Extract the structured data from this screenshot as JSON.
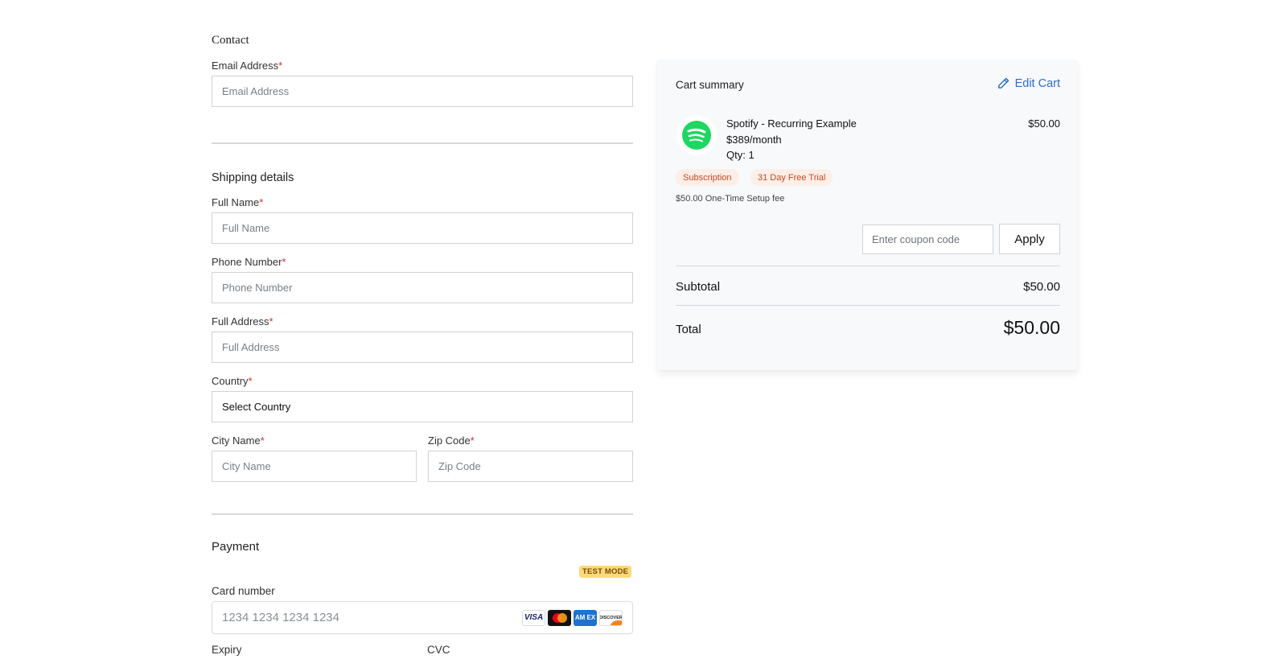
{
  "contact": {
    "title": "Contact",
    "email_label": "Email Address",
    "email_placeholder": "Email Address"
  },
  "shipping": {
    "title": "Shipping details",
    "full_name_label": "Full Name",
    "full_name_placeholder": "Full Name",
    "phone_label": "Phone Number",
    "phone_placeholder": "Phone Number",
    "address_label": "Full Address",
    "address_placeholder": "Full Address",
    "country_label": "Country",
    "country_value": "Select Country",
    "city_label": "City Name",
    "city_placeholder": "City Name",
    "zip_label": "Zip Code",
    "zip_placeholder": "Zip Code",
    "required_mark": "*"
  },
  "payment": {
    "title": "Payment",
    "test_mode_badge": "TEST MODE",
    "card_label": "Card number",
    "card_placeholder": "1234 1234 1234 1234",
    "expiry_label": "Expiry",
    "cvc_label": "CVC",
    "brands": {
      "visa": "VISA",
      "amex": "AM EX",
      "discover": "DISCOVER"
    }
  },
  "cart": {
    "title": "Cart summary",
    "edit_label": "Edit Cart",
    "item": {
      "name": "Spotify - Recurring Example",
      "price_per_period": "$389/month",
      "qty": "Qty: 1",
      "amount": "$50.00",
      "tags": [
        "Subscription",
        "31 Day Free Trial"
      ],
      "setup_fee": "$50.00 One-Time Setup fee"
    },
    "coupon_placeholder": "Enter coupon code",
    "apply_label": "Apply",
    "subtotal_label": "Subtotal",
    "subtotal_value": "$50.00",
    "total_label": "Total",
    "total_value": "$50.00"
  },
  "colors": {
    "accent": "#2c6fc7",
    "spotify_green": "#1ed760",
    "required": "#d0302b",
    "tag_bg": "#fdeee7",
    "tag_text": "#c64a22"
  }
}
